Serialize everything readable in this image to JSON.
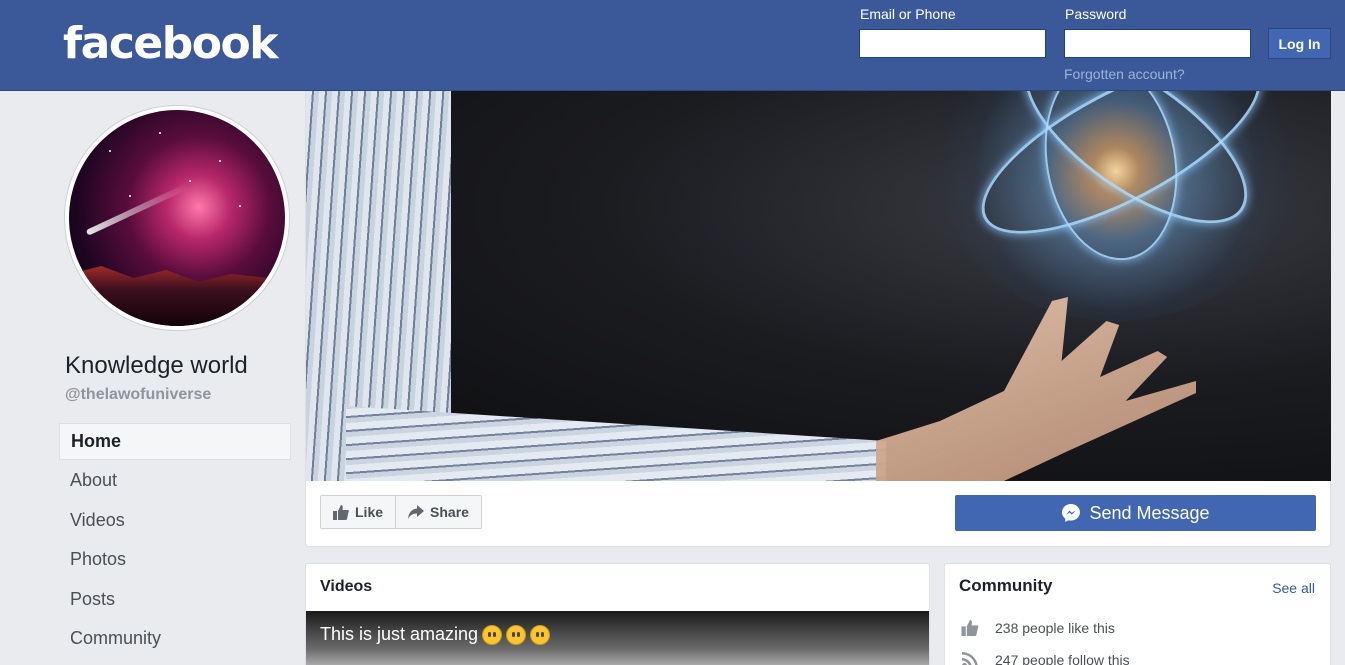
{
  "header": {
    "logo": "facebook",
    "email_label": "Email or Phone",
    "email_value": "",
    "password_label": "Password",
    "password_value": "",
    "login_button": "Log In",
    "forgot_link": "Forgotten account?"
  },
  "page": {
    "name": "Knowledge world",
    "handle": "@thelawofuniverse"
  },
  "nav": {
    "items": [
      {
        "label": "Home",
        "active": true
      },
      {
        "label": "About"
      },
      {
        "label": "Videos"
      },
      {
        "label": "Photos"
      },
      {
        "label": "Posts"
      },
      {
        "label": "Community"
      }
    ]
  },
  "actions": {
    "like": "Like",
    "share": "Share",
    "send_message": "Send Message"
  },
  "videos": {
    "title": "Videos",
    "caption": "This is just amazing",
    "emoji_count": 3
  },
  "community": {
    "title": "Community",
    "see_all": "See all",
    "rows": [
      {
        "icon": "thumbs-up-icon",
        "text": "238 people like this"
      },
      {
        "icon": "rss-follow-icon",
        "text": "247 people follow this"
      }
    ]
  },
  "colors": {
    "brand": "#3b5998",
    "button": "#4267b2",
    "link": "#385898"
  }
}
